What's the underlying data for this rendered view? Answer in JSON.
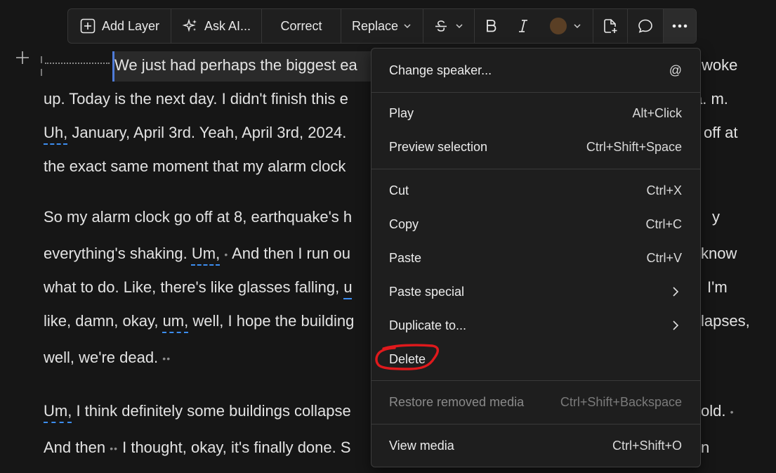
{
  "toolbar": {
    "add_layer": "Add Layer",
    "ask_ai": "Ask AI...",
    "correct": "Correct",
    "replace": "Replace",
    "color_swatch": "#5a3f25",
    "icons": [
      "plus-square-icon",
      "sparkle-icon",
      "strikethrough-icon",
      "bold-icon",
      "italic-icon",
      "new-doc-icon",
      "comment-icon",
      "more-icon"
    ]
  },
  "editor": {
    "lines": [
      {
        "pre": "We just had perhaps the biggest ea",
        "post": "woke"
      },
      {
        "pre": "up. Today is the next day. I didn't finish this e",
        "post": "a. m."
      },
      {
        "fill": "Uh,",
        "pre": " January, April 3rd. Yeah, April 3rd, 2024.",
        "post": "off at"
      },
      {
        "pre": "the exact same moment that my alarm clock"
      },
      {
        "pre": "So my alarm clock go off at 8, earthquake's h",
        "post": "y"
      },
      {
        "pre": "everything's shaking. ",
        "fill": "Um,",
        "gap": "•",
        "mid": " And then I run ou",
        "post": "know"
      },
      {
        "pre": "what to do. Like, there's like glasses falling, ",
        "fill": "u",
        "post": "I'm"
      },
      {
        "pre": "like, damn, okay, ",
        "fill": "um,",
        "mid": " well, I hope the building",
        "post": "lapses,"
      },
      {
        "pre": "well, we're dead. ",
        "gap": "••"
      },
      {
        "fill": "Um,",
        "pre": " I think definitely some buildings collapse",
        "post": "old.",
        "gap": "•"
      },
      {
        "pre": "And then ",
        "gap": "••",
        "mid": " I thought, okay, it's finally done. S",
        "post": "n"
      }
    ]
  },
  "menu": {
    "items": [
      {
        "label": "Change speaker...",
        "shortcut": "@"
      },
      {
        "label": "Play",
        "shortcut": "Alt+Click"
      },
      {
        "label": "Preview selection",
        "shortcut": "Ctrl+Shift+Space"
      },
      {
        "label": "Cut",
        "shortcut": "Ctrl+X"
      },
      {
        "label": "Copy",
        "shortcut": "Ctrl+C"
      },
      {
        "label": "Paste",
        "shortcut": "Ctrl+V"
      },
      {
        "label": "Paste special",
        "shortcut": ""
      },
      {
        "label": "Duplicate to...",
        "shortcut": ""
      },
      {
        "label": "Delete",
        "shortcut": ""
      },
      {
        "label": "Restore removed media",
        "shortcut": "Ctrl+Shift+Backspace"
      },
      {
        "label": "View media",
        "shortcut": "Ctrl+Shift+O"
      }
    ],
    "highlight_color": "#e0191c"
  }
}
